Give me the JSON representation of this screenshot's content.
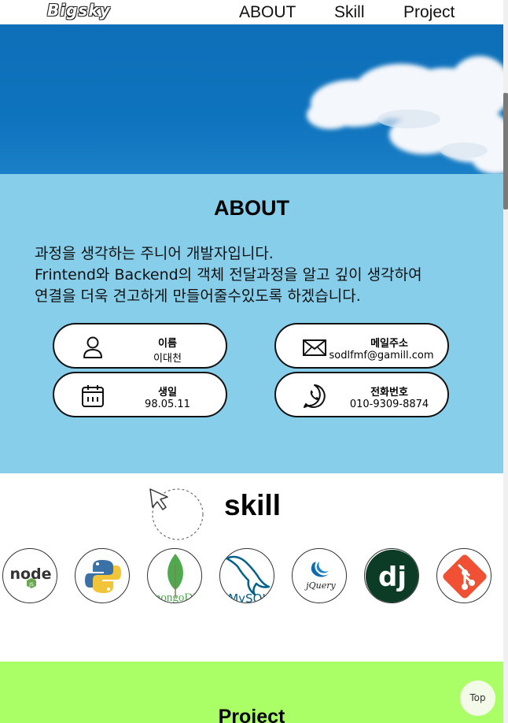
{
  "header": {
    "logo": "Bigsky",
    "nav": [
      "ABOUT",
      "Skill",
      "Project"
    ]
  },
  "about": {
    "title": "ABOUT",
    "lines": [
      "과정을 생각하는 주니어 개발자입니다.",
      "Frintend와 Backend의 객체 전달과정을 알고 깊이 생각하여",
      "연결을 더욱 견고하게 만들어줄수있도록 하겠습니다."
    ],
    "cards": {
      "name": {
        "label": "이름",
        "value": "이대천",
        "icon": "user-icon"
      },
      "email": {
        "label": "메일주소",
        "value": "sodlfmf@gamill.com",
        "icon": "mail-icon"
      },
      "birth": {
        "label": "생일",
        "value": "98.05.11",
        "icon": "calendar-icon"
      },
      "phone": {
        "label": "전화번호",
        "value": "010-9309-8874",
        "icon": "phone-icon"
      }
    }
  },
  "skill": {
    "title": "skill",
    "icons": [
      "nodejs-icon",
      "python-icon",
      "mongodb-icon",
      "mysql-icon",
      "jquery-icon",
      "django-icon",
      "git-icon"
    ],
    "icon_text": {
      "node": "node",
      "mongodb": "mongoDB",
      "mysql": "MySQL",
      "jquery": "jQuery",
      "django": "dj"
    }
  },
  "project": {
    "title": "Project"
  },
  "top_button": "Top",
  "colors": {
    "about_bg": "#87ceeb",
    "project_bg": "#aaff66",
    "hero_sky": "#0e6fb8"
  }
}
